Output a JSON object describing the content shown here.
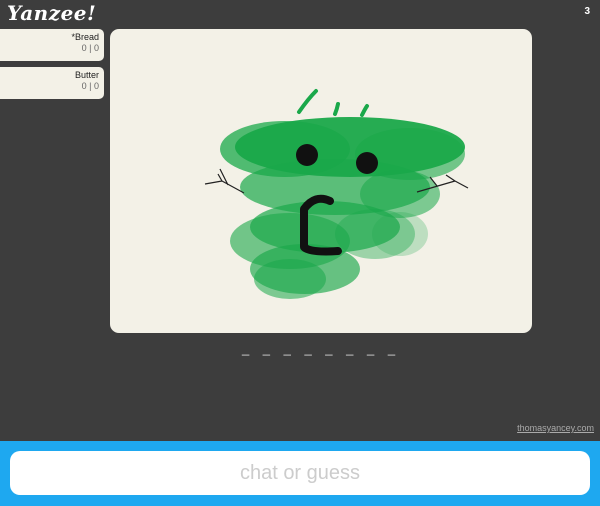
{
  "app": {
    "logo": "Yanzee!",
    "round_counter": "3",
    "credit_link": "thomasyancey.com"
  },
  "players": [
    {
      "name": "*Bread",
      "score": "0 | 0"
    },
    {
      "name": "Butter",
      "score": "0 | 0"
    }
  ],
  "word": {
    "blanks": "_ _ _ _ _ _ _ _"
  },
  "chat": {
    "placeholder": "chat or guess",
    "value": ""
  },
  "colors": {
    "background": "#3d3d3d",
    "canvas": "#f3f1e7",
    "chat_bar": "#1ea8f0",
    "brush_green": "#1aa84a",
    "brush_dark": "#111111"
  },
  "canvas": {
    "drawing": "green blob face with hair strands and stick arms"
  }
}
